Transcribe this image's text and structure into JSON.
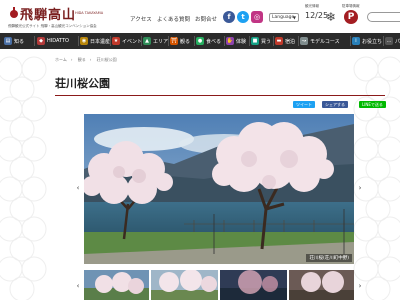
{
  "header": {
    "logo_title": "飛騨高山",
    "logo_subtitle": "HIDA TAKAYAMA",
    "logo_tagline": "飛騨観光公式サイト 飛騨・高山観光コンベンション協会",
    "links": [
      "アクセス",
      "よくある質問",
      "お問合せ"
    ],
    "language_label": "Language",
    "weather_label": "観光情報",
    "parking_label": "駐車場情報",
    "date": "12/25",
    "colors": {
      "brand": "#7a1f1f",
      "facebook": "#3b5998",
      "twitter": "#1da1f2",
      "instagram": "#c13584"
    }
  },
  "nav": {
    "items": [
      {
        "label": "知る",
        "icon": "book-icon",
        "color": "#4a6fa5"
      },
      {
        "label": "HIDATTO",
        "icon": "hidatto-icon",
        "color": "#b33a3a"
      },
      {
        "label": "日本遺産",
        "icon": "heritage-icon",
        "color": "#b8860b"
      },
      {
        "label": "イベント",
        "icon": "event-icon",
        "color": "#c0392b"
      },
      {
        "label": "エリア",
        "icon": "map-icon",
        "color": "#2e8b57"
      },
      {
        "label": "観る",
        "icon": "torii-icon",
        "color": "#d35400"
      },
      {
        "label": "食べる",
        "icon": "bowl-icon",
        "color": "#27ae60"
      },
      {
        "label": "体験",
        "icon": "hand-icon",
        "color": "#8e44ad"
      },
      {
        "label": "買う",
        "icon": "bag-icon",
        "color": "#16a085"
      },
      {
        "label": "宿泊",
        "icon": "bed-icon",
        "color": "#c0392b"
      },
      {
        "label": "モデルコース",
        "icon": "route-icon",
        "color": "#7f8c8d"
      },
      {
        "label": "お役立ち",
        "icon": "info-icon",
        "color": "#2980b9"
      },
      {
        "label": "パン",
        "icon": "more-icon",
        "color": "#555555"
      }
    ]
  },
  "breadcrumb": [
    "ホーム",
    "観る",
    "荘川桜公園"
  ],
  "page_title": "荘川桜公園",
  "share": {
    "tweet": "ツイート",
    "facebook": "シェアする",
    "line": "LINEで送る"
  },
  "slider": {
    "caption": "荘川桜(荘川町中野)",
    "prev": "‹",
    "next": "›"
  }
}
